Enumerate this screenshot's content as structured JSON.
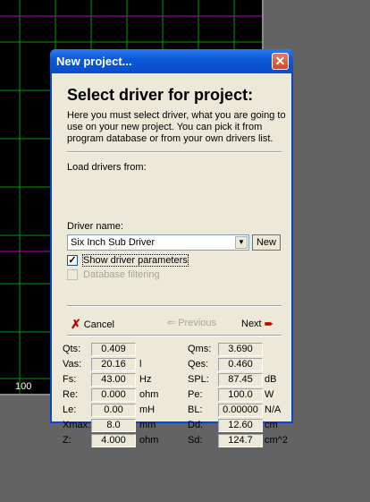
{
  "graph": {
    "axis_label": "100"
  },
  "dialog": {
    "title": "New project...",
    "heading": "Select driver for project:",
    "description": "Here you must select driver, what you are going to use on your new project. You can pick it from program database or from your own drivers list.",
    "load_label": "Load drivers from:",
    "driver_name_label": "Driver name:",
    "driver_selected": "Six Inch Sub Driver",
    "new_button": "New",
    "show_params_label": "Show driver parameters",
    "show_params_checked": true,
    "db_filter_label": "Database filtering",
    "db_filter_checked": false,
    "cancel_label": "Cancel",
    "previous_label": "Previous",
    "next_label": "Next"
  },
  "params": {
    "left": [
      {
        "name": "Qts:",
        "value": "0.409",
        "unit": ""
      },
      {
        "name": "Vas:",
        "value": "20.16",
        "unit": "l"
      },
      {
        "name": "Fs:",
        "value": "43.00",
        "unit": "Hz"
      },
      {
        "name": "Re:",
        "value": "0.000",
        "unit": "ohm"
      },
      {
        "name": "Le:",
        "value": "0.00",
        "unit": "mH"
      },
      {
        "name": "Xmax:",
        "value": "8.0",
        "unit": "mm"
      },
      {
        "name": "Z:",
        "value": "4.000",
        "unit": "ohm"
      }
    ],
    "right": [
      {
        "name": "Qms:",
        "value": "3.690",
        "unit": ""
      },
      {
        "name": "Qes:",
        "value": "0.460",
        "unit": ""
      },
      {
        "name": "SPL:",
        "value": "87.45",
        "unit": "dB"
      },
      {
        "name": "Pe:",
        "value": "100.0",
        "unit": "W"
      },
      {
        "name": "BL:",
        "value": "0.00000",
        "unit": "N/A"
      },
      {
        "name": "Dd:",
        "value": "12.60",
        "unit": "cm"
      },
      {
        "name": "Sd:",
        "value": "124.7",
        "unit": "cm^2"
      }
    ]
  },
  "colors": {
    "desktop": "#636363",
    "grid_green": "#00a000",
    "grid_magenta": "#c000c0",
    "titlebar": "#0b5ad9",
    "dialog_bg": "#ece9d8"
  }
}
